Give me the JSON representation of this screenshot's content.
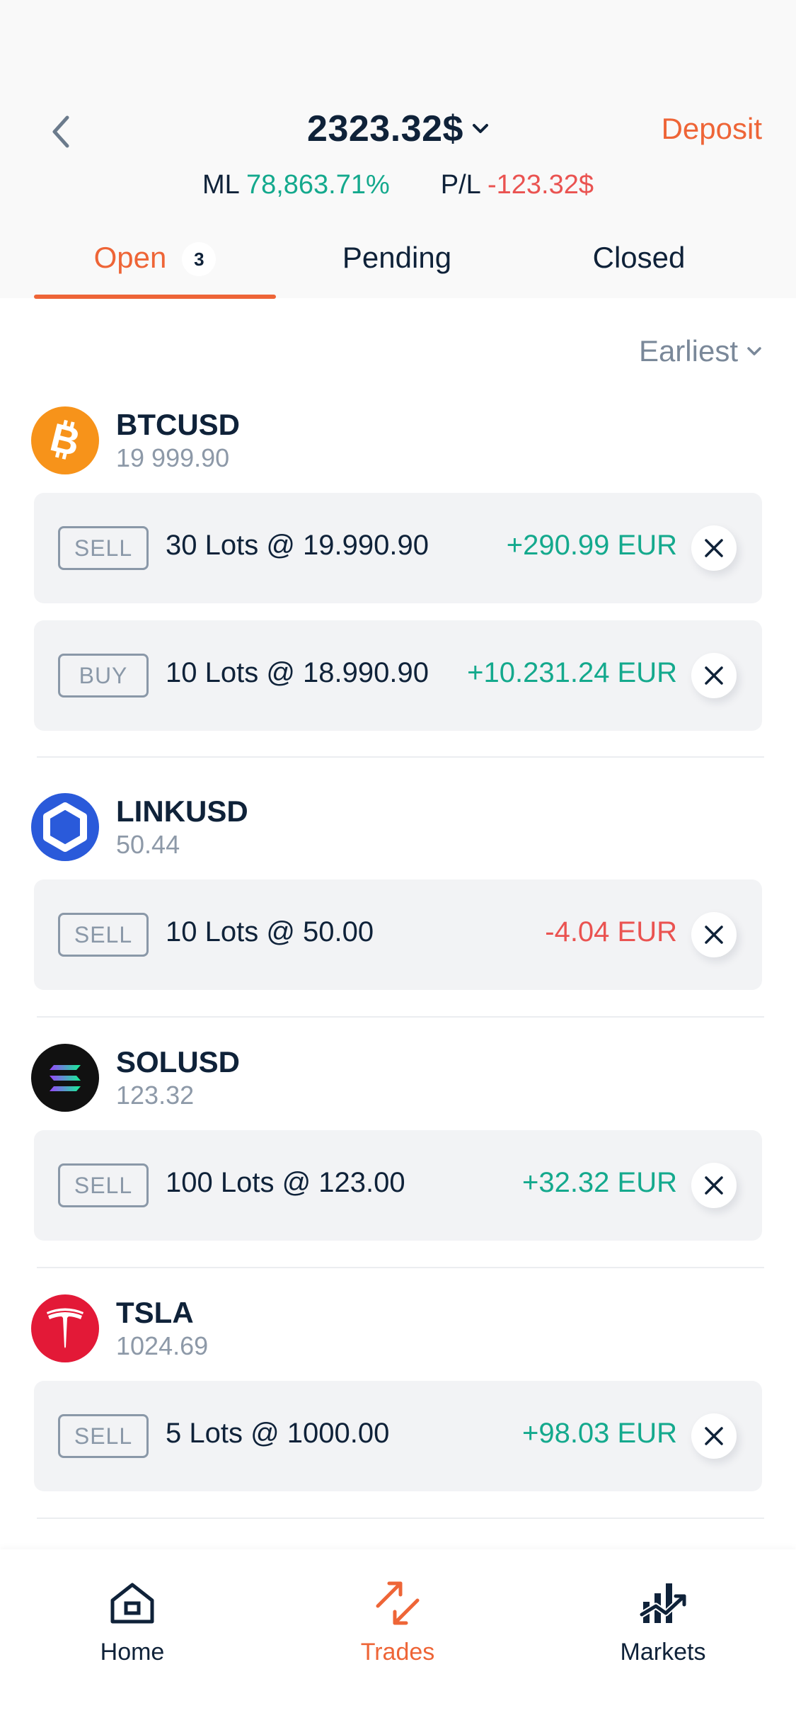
{
  "header": {
    "balance": "2323.32$",
    "deposit_label": "Deposit",
    "ml_label": "ML",
    "ml_value": "78,863.71%",
    "pl_label": "P/L",
    "pl_value": "-123.32$"
  },
  "tabs": [
    {
      "label": "Open",
      "badge": "3"
    },
    {
      "label": "Pending"
    },
    {
      "label": "Closed"
    }
  ],
  "sort": {
    "label": "Earliest"
  },
  "instruments": [
    {
      "symbol": "BTCUSD",
      "price": "19 999.90",
      "trades": [
        {
          "side": "SELL",
          "desc": "30 Lots @ 19.990.90",
          "pl": "+290.99 EUR"
        },
        {
          "side": "BUY",
          "desc": "10 Lots @ 18.990.90",
          "pl": "+10.231.24 EUR"
        }
      ]
    },
    {
      "symbol": "LINKUSD",
      "price": "50.44",
      "trades": [
        {
          "side": "SELL",
          "desc": "10 Lots @ 50.00",
          "pl": "-4.04 EUR"
        }
      ]
    },
    {
      "symbol": "SOLUSD",
      "price": "123.32",
      "trades": [
        {
          "side": "SELL",
          "desc": "100 Lots @ 123.00",
          "pl": "+32.32 EUR"
        }
      ]
    },
    {
      "symbol": "TSLA",
      "price": "1024.69",
      "trades": [
        {
          "side": "SELL",
          "desc": "5 Lots @ 1000.00",
          "pl": "+98.03 EUR"
        }
      ]
    }
  ],
  "bottom_nav": [
    {
      "label": "Home",
      "icon": "home-icon"
    },
    {
      "label": "Trades",
      "icon": "trades-icon"
    },
    {
      "label": "Markets",
      "icon": "markets-icon"
    }
  ],
  "colors": {
    "accent": "#ee6537",
    "positive": "#14a98d",
    "negative": "#ea5351",
    "text": "#0f2239"
  }
}
